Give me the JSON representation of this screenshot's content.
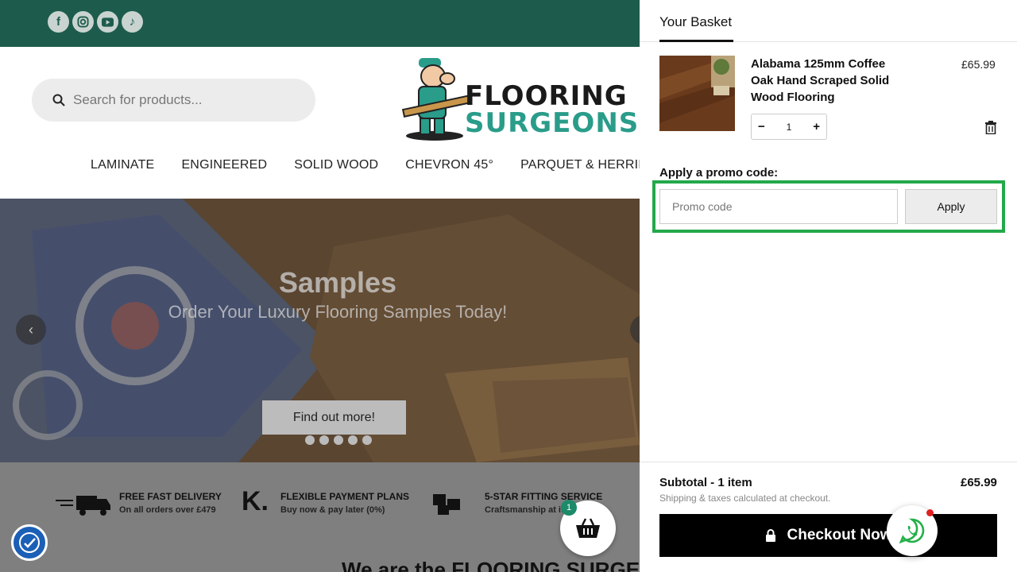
{
  "site": {
    "social_icons": [
      "facebook-icon",
      "instagram-icon",
      "youtube-icon",
      "tiktok-icon"
    ],
    "search": {
      "placeholder": "Search for products..."
    },
    "logo": {
      "word1": "FLOORING",
      "word2": "SURGEONS"
    },
    "nav": [
      "LAMINATE",
      "ENGINEERED",
      "SOLID WOOD",
      "CHEVRON 45°",
      "PARQUET & HERRINGBONE"
    ],
    "hero": {
      "title": "Samples",
      "subtitle": "Order Your Luxury Flooring Samples Today!",
      "button": "Find out more!"
    },
    "usps": [
      {
        "title": "FREE FAST DELIVERY",
        "sub": "On all orders over £479"
      },
      {
        "title": "FLEXIBLE PAYMENT PLANS",
        "sub": "Buy now & pay later (0%)"
      },
      {
        "title": "5-STAR FITTING SERVICE",
        "sub": "Craftsmanship at its"
      }
    ],
    "bottom_text": "We are the FLOORING SURGEONS",
    "cart_count": "1"
  },
  "basket": {
    "title": "Your Basket",
    "item": {
      "name": "Alabama 125mm Coffee Oak Hand Scraped Solid Wood Flooring",
      "price": "£65.99",
      "quantity": "1"
    },
    "promo": {
      "label": "Apply a promo code:",
      "placeholder": "Promo code",
      "apply": "Apply"
    },
    "subtotal_label": "Subtotal - 1 item",
    "subtotal_value": "£65.99",
    "shipping_note": "Shipping & taxes calculated at checkout.",
    "checkout": "Checkout Now"
  },
  "colors": {
    "brand_green": "#1d5c4c",
    "highlight": "#22a94a",
    "checkout_bg": "#000000"
  }
}
